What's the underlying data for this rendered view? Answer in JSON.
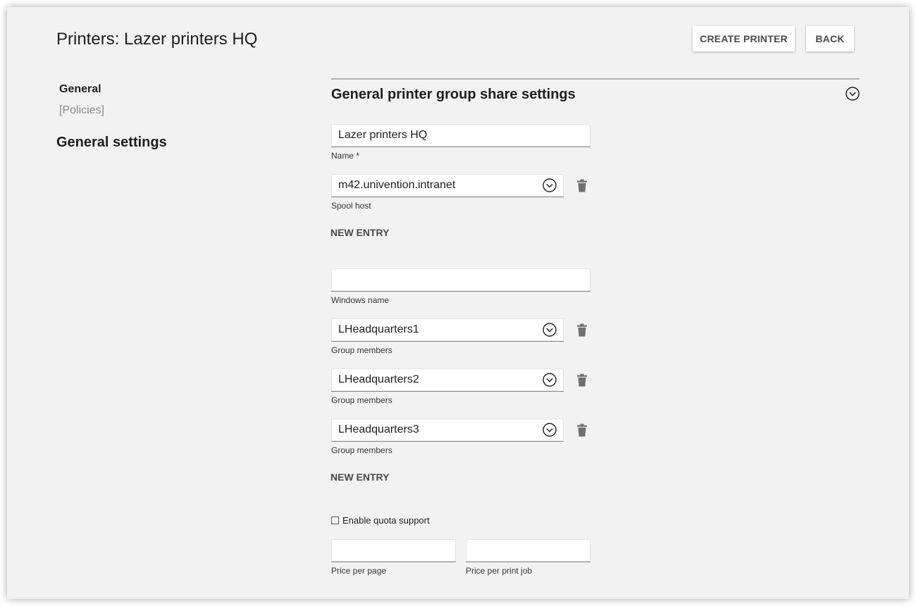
{
  "header": {
    "title": "Printers: Lazer printers HQ",
    "create_button": "CREATE PRINTER",
    "back_button": "BACK"
  },
  "sidebar": {
    "nav": [
      {
        "label": "General"
      },
      {
        "label": "[Policies]"
      }
    ],
    "heading": "General settings"
  },
  "section": {
    "title": "General printer group share settings"
  },
  "form": {
    "name": {
      "value": "Lazer printers HQ",
      "label": "Name *"
    },
    "spool_host": {
      "value": "m42.univention.intranet",
      "label": "Spool host"
    },
    "new_entry_label": "NEW ENTRY",
    "windows_name": {
      "value": "",
      "label": "Windows name"
    },
    "group_members": [
      {
        "value": "LHeadquarters1",
        "label": "Group members"
      },
      {
        "value": "LHeadquarters2",
        "label": "Group members"
      },
      {
        "value": "LHeadquarters3",
        "label": "Group members"
      }
    ],
    "quota": {
      "label": "Enable quota support",
      "checked": false
    },
    "price_per_page": {
      "value": "",
      "label": "Price per page"
    },
    "price_per_job": {
      "value": "",
      "label": "Price per print job"
    }
  },
  "icons": {
    "expand": "chevron-circle-icon",
    "delete": "trash-icon"
  },
  "colors": {
    "background": "#f2f2f2",
    "field": "#ffffff",
    "muted_text": "#8a8a8a"
  }
}
